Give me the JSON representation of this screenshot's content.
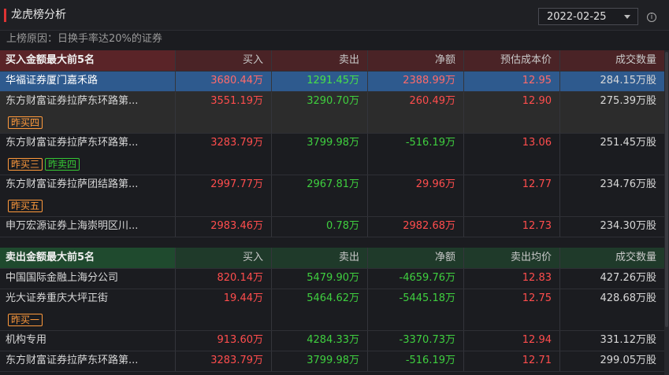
{
  "header": {
    "title": "龙虎榜分析",
    "date": "2022-02-25",
    "reason": "上榜原因：日换手率达20%的证券"
  },
  "buy_table": {
    "title": "买入金额最大前5名",
    "columns": [
      "买入",
      "卖出",
      "净额",
      "预估成本价",
      "成交数量"
    ],
    "rows": [
      {
        "name": "华福证券厦门嘉禾路",
        "buy": "3680.44万",
        "sell": "1291.45万",
        "net": "2388.99万",
        "price": "12.95",
        "volume": "284.15万股",
        "tags": [],
        "selected": true
      },
      {
        "name": "东方财富证券拉萨东环路第...",
        "buy": "3551.19万",
        "sell": "3290.70万",
        "net": "260.49万",
        "price": "12.90",
        "volume": "275.39万股",
        "tags": [
          "昨买四"
        ]
      },
      {
        "name": "东方财富证券拉萨东环路第...",
        "buy": "3283.79万",
        "sell": "3799.98万",
        "net": "-516.19万",
        "price": "13.06",
        "volume": "251.45万股",
        "tags": [
          "昨买三",
          "昨卖四"
        ]
      },
      {
        "name": "东方财富证券拉萨团结路第...",
        "buy": "2997.77万",
        "sell": "2967.81万",
        "net": "29.96万",
        "price": "12.77",
        "volume": "234.76万股",
        "tags": [
          "昨买五"
        ]
      },
      {
        "name": "申万宏源证券上海崇明区川...",
        "buy": "2983.46万",
        "sell": "0.78万",
        "net": "2982.68万",
        "price": "12.73",
        "volume": "234.30万股",
        "tags": []
      }
    ]
  },
  "sell_table": {
    "title": "卖出金额最大前5名",
    "columns": [
      "买入",
      "卖出",
      "净额",
      "卖出均价",
      "成交数量"
    ],
    "rows": [
      {
        "name": "中国国际金融上海分公司",
        "buy": "820.14万",
        "sell": "5479.90万",
        "net": "-4659.76万",
        "price": "12.83",
        "volume": "427.26万股",
        "tags": []
      },
      {
        "name": "光大证券重庆大坪正街",
        "buy": "19.44万",
        "sell": "5464.62万",
        "net": "-5445.18万",
        "price": "12.75",
        "volume": "428.68万股",
        "tags": [
          "昨买一"
        ]
      },
      {
        "name": "机构专用",
        "buy": "913.60万",
        "sell": "4284.33万",
        "net": "-3370.73万",
        "price": "12.94",
        "volume": "331.12万股",
        "tags": []
      },
      {
        "name": "东方财富证券拉萨东环路第...",
        "buy": "3283.79万",
        "sell": "3799.98万",
        "net": "-516.19万",
        "price": "12.71",
        "volume": "299.05万股",
        "tags": []
      }
    ]
  },
  "colors": {
    "up": "#ff4d4d",
    "down": "#3fcf3f",
    "accent": "#dd3333",
    "selected_row": "#2e5a8e"
  }
}
